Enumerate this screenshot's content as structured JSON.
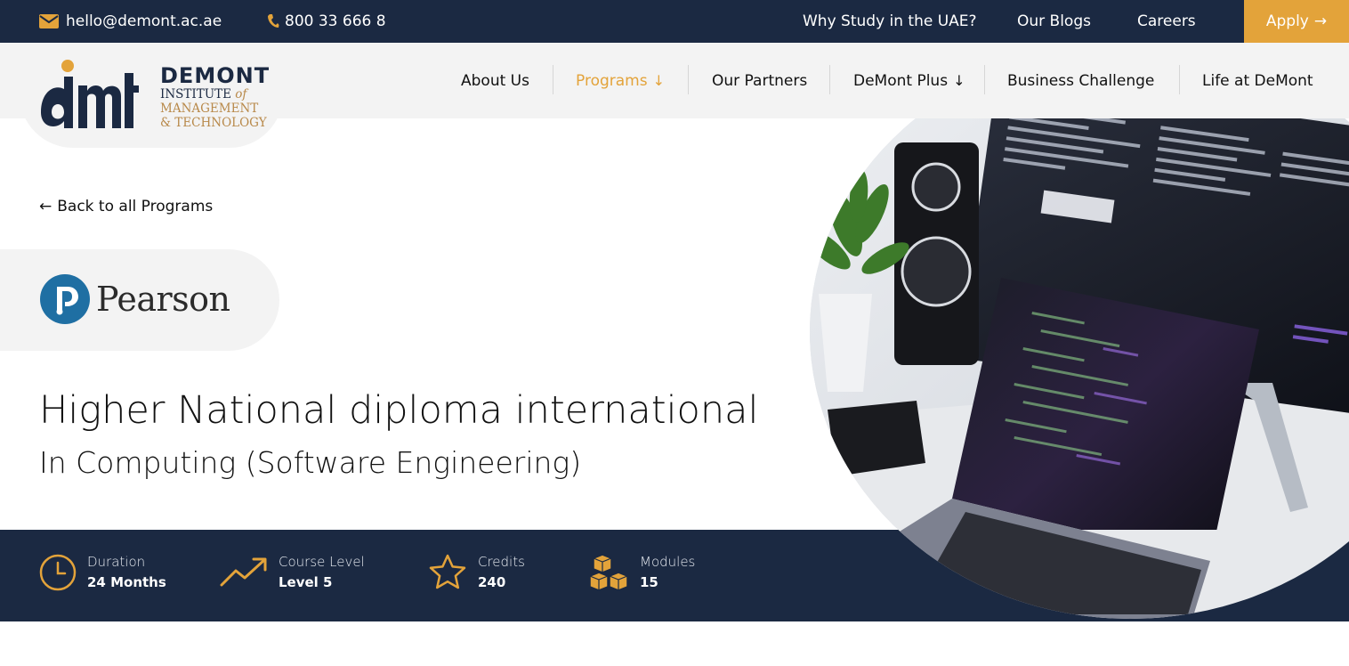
{
  "topbar": {
    "email": "hello@demont.ac.ae",
    "phone": "800 33 666 8",
    "links": [
      "Why Study in the UAE?",
      "Our Blogs",
      "Careers"
    ],
    "apply_label": "Apply",
    "apply_arrow": "→"
  },
  "logo": {
    "name": "DEMONT",
    "line1": "INSTITUTE",
    "line1_of": "of",
    "line2": "MANAGEMENT",
    "line3": "& TECHNOLOGY"
  },
  "nav": {
    "items": [
      {
        "label": "About Us"
      },
      {
        "label": "Programs",
        "dropdown": "↓"
      },
      {
        "label": "Our Partners"
      },
      {
        "label": "DeMont Plus",
        "dropdown": "↓"
      },
      {
        "label": "Business Challenge"
      },
      {
        "label": "Life at DeMont"
      }
    ]
  },
  "hero": {
    "back_arrow": "←",
    "back_label": "Back to all Programs",
    "partner": "Pearson",
    "title": "Higher National diploma international",
    "subtitle": "In Computing (Software Engineering)"
  },
  "stats": [
    {
      "icon": "clock-icon",
      "label": "Duration",
      "value": "24 Months"
    },
    {
      "icon": "trend-up-icon",
      "label": "Course Level",
      "value": "Level 5"
    },
    {
      "icon": "star-icon",
      "label": "Credits",
      "value": "240"
    },
    {
      "icon": "cubes-icon",
      "label": "Modules",
      "value": "15"
    }
  ],
  "colors": {
    "navy": "#1b2942",
    "gold": "#e3a33a",
    "light_gray": "#f3f3f3"
  }
}
